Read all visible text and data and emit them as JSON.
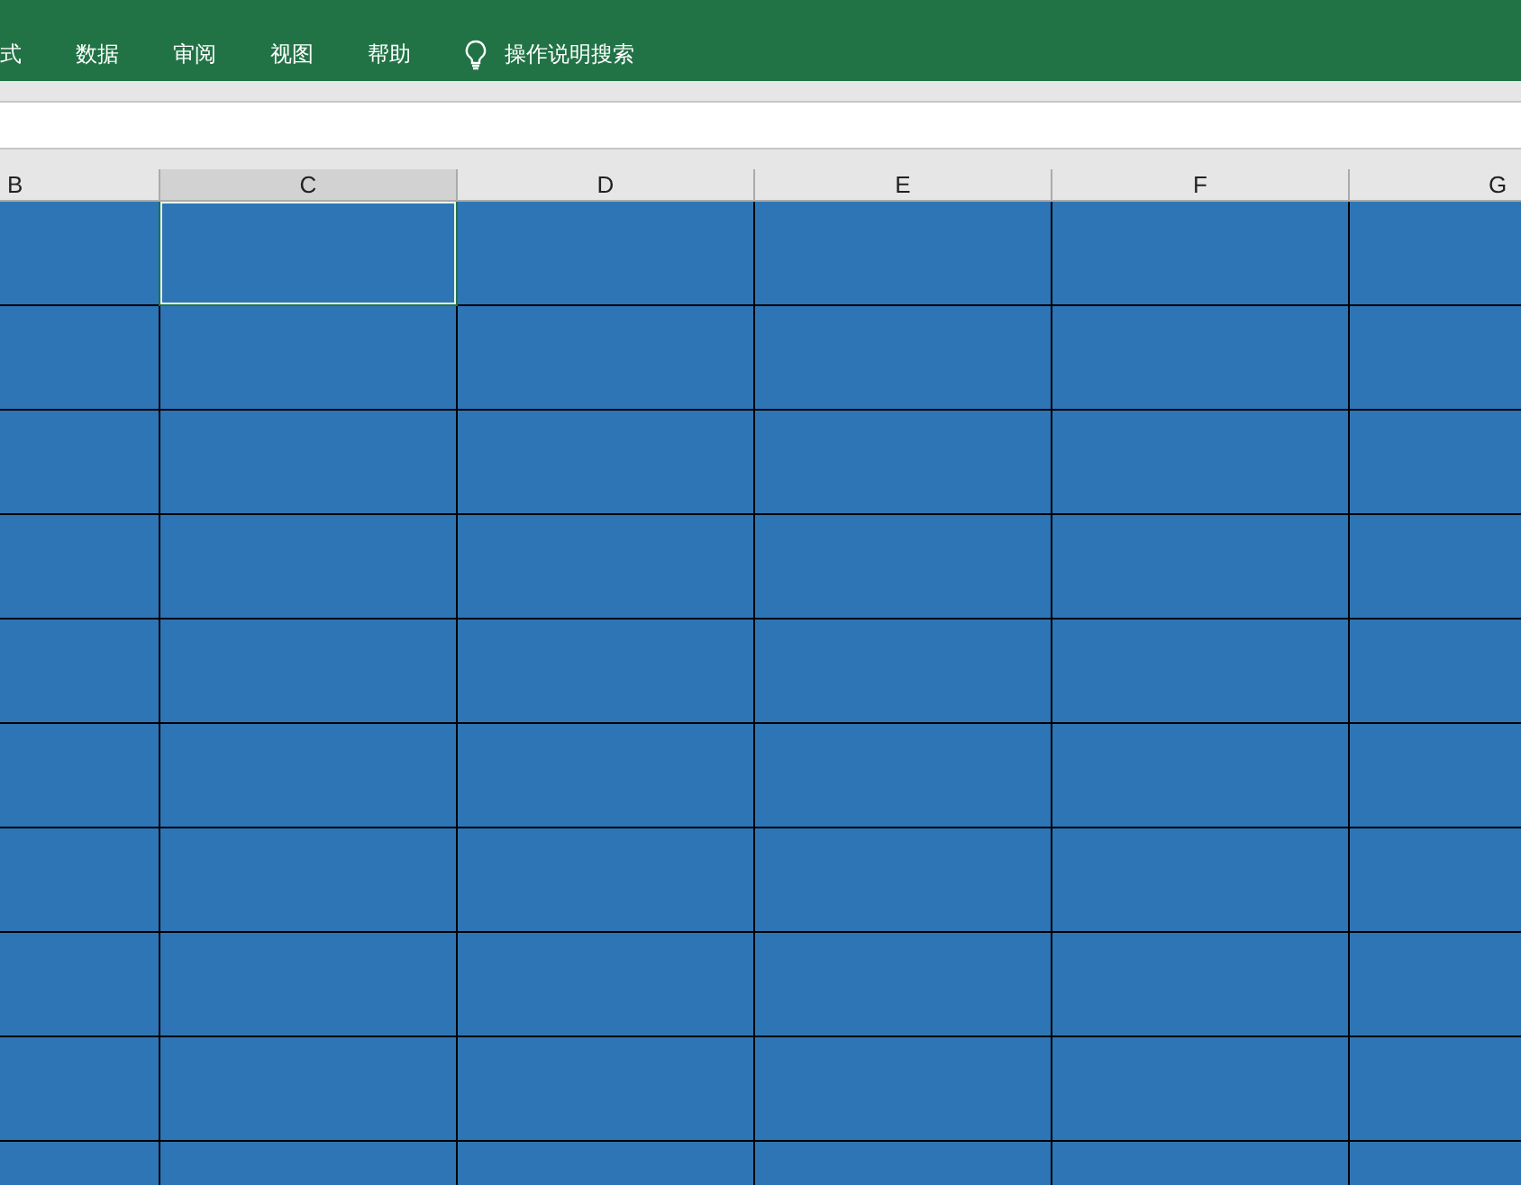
{
  "ribbon_tabs": [
    {
      "label": "式",
      "kind": "tab"
    },
    {
      "label": "数据",
      "kind": "tab"
    },
    {
      "label": "审阅",
      "kind": "tab"
    },
    {
      "label": "视图",
      "kind": "tab"
    },
    {
      "label": "帮助",
      "kind": "tab"
    },
    {
      "label": "操作说明搜索",
      "kind": "search"
    }
  ],
  "columns": [
    {
      "label": "B",
      "selected": false
    },
    {
      "label": "C",
      "selected": true
    },
    {
      "label": "D",
      "selected": false
    },
    {
      "label": "E",
      "selected": false
    },
    {
      "label": "F",
      "selected": false
    },
    {
      "label": "G",
      "selected": false
    }
  ]
}
